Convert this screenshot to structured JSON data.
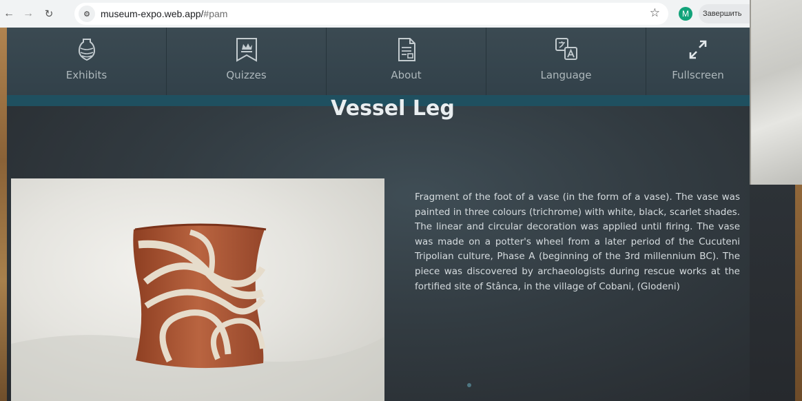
{
  "browser": {
    "url_host": "museum-expo.web.app/",
    "url_hash": "#pam",
    "profile_initial": "M",
    "finish_label": "Завершить"
  },
  "nav": {
    "items": [
      {
        "label": "Exhibits",
        "icon": "vase-icon"
      },
      {
        "label": "Quizzes",
        "icon": "crown-bookmark-icon"
      },
      {
        "label": "About",
        "icon": "document-icon"
      },
      {
        "label": "Language",
        "icon": "translate-icon"
      },
      {
        "label": "Fullscreen",
        "icon": "expand-icon"
      }
    ]
  },
  "exhibit": {
    "title": "Vessel Leg",
    "description": "Fragment of the foot of a vase (in the form of a vase). The vase was painted in three colours (trichrome) with white, black, scarlet shades. The linear and circular decoration was applied until firing. The vase was made on a potter's wheel from a later period of the Cucuteni Tripolian culture, Phase A (beginning of the 3rd millennium BC). The piece was discovered by archaeologists during rescue works at the fortified site of Stânca, in the village of Cobani, (Glodeni)"
  },
  "colors": {
    "app_bg": "#323b41",
    "nav_bg": "#3b4a52",
    "accent_strip": "#1f5060",
    "text_light": "#d6dcdf",
    "pottery": "#b5603c"
  }
}
